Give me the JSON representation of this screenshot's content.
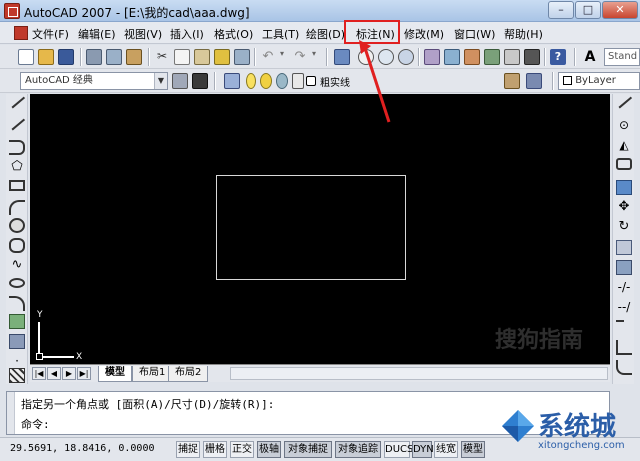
{
  "window": {
    "title": "AutoCAD 2007 - [E:\\我的cad\\aaa.dwg]"
  },
  "menubar": {
    "items": [
      {
        "label": "文件(F)"
      },
      {
        "label": "编辑(E)"
      },
      {
        "label": "视图(V)"
      },
      {
        "label": "插入(I)"
      },
      {
        "label": "格式(O)"
      },
      {
        "label": "工具(T)"
      },
      {
        "label": "绘图(D)"
      },
      {
        "label": "标注(N)"
      },
      {
        "label": "修改(M)"
      },
      {
        "label": "窗口(W)"
      },
      {
        "label": "帮助(H)"
      }
    ]
  },
  "toolbar2": {
    "workspace": "AutoCAD 经典",
    "layer": "粗实线",
    "color": "ByLayer"
  },
  "toolbar1": {
    "text_style": "Stand"
  },
  "canvas": {
    "ucs_x": "X",
    "ucs_y": "Y",
    "watermark": "搜狗指南"
  },
  "tabs": {
    "model": "模型",
    "layout1": "布局1",
    "layout2": "布局2"
  },
  "command": {
    "line1": "指定另一个角点或 [面积(A)/尺寸(D)/旋转(R)]:",
    "line2": "命令:"
  },
  "statusbar": {
    "coords": "29.5691, 18.8416, 0.0000",
    "buttons": [
      {
        "label": "捕捉"
      },
      {
        "label": "栅格"
      },
      {
        "label": "正交"
      },
      {
        "label": "极轴"
      },
      {
        "label": "对象捕捉"
      },
      {
        "label": "对象追踪"
      },
      {
        "label": "DUCS"
      },
      {
        "label": "DYN"
      },
      {
        "label": "线宽"
      },
      {
        "label": "模型"
      }
    ]
  },
  "logo": {
    "text": "系统城",
    "url": "xitongcheng.com"
  },
  "colors": {
    "highlight": "#e02020",
    "canvas": "#000000"
  }
}
